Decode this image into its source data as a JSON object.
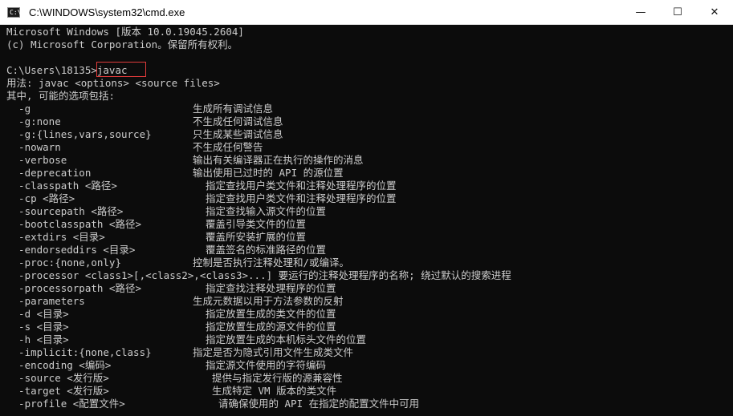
{
  "window": {
    "title": "C:\\WINDOWS\\system32\\cmd.exe",
    "icon_glyph": "C:\\",
    "minimize_glyph": "—",
    "maximize_glyph": "☐",
    "close_glyph": "✕"
  },
  "console": {
    "lines": [
      "Microsoft Windows [版本 10.0.19045.2604]",
      "(c) Microsoft Corporation。保留所有权利。",
      "",
      "C:\\Users\\18135>javac",
      "用法: javac <options> <source files>",
      "其中, 可能的选项包括:"
    ],
    "options": [
      {
        "flag": "  -g",
        "desc": "生成所有调试信息"
      },
      {
        "flag": "  -g:none",
        "desc": "不生成任何调试信息"
      },
      {
        "flag": "  -g:{lines,vars,source}",
        "desc": "只生成某些调试信息"
      },
      {
        "flag": "  -nowarn",
        "desc": "不生成任何警告"
      },
      {
        "flag": "  -verbose",
        "desc": "输出有关编译器正在执行的操作的消息"
      },
      {
        "flag": "  -deprecation",
        "desc": "输出使用已过时的 API 的源位置"
      },
      {
        "flag": "  -classpath <路径>",
        "desc": "指定查找用户类文件和注释处理程序的位置"
      },
      {
        "flag": "  -cp <路径>",
        "desc": "指定查找用户类文件和注释处理程序的位置"
      },
      {
        "flag": "  -sourcepath <路径>",
        "desc": "指定查找输入源文件的位置"
      },
      {
        "flag": "  -bootclasspath <路径>",
        "desc": "覆盖引导类文件的位置"
      },
      {
        "flag": "  -extdirs <目录>",
        "desc": "覆盖所安装扩展的位置"
      },
      {
        "flag": "  -endorseddirs <目录>",
        "desc": "覆盖签名的标准路径的位置"
      },
      {
        "flag": "  -proc:{none,only}",
        "desc": "控制是否执行注释处理和/或编译。"
      },
      {
        "flag": "  -processor <class1>[,<class2>,<class3>...] 要运行的注释处理程序的名称; 绕过默认的搜索进程",
        "desc": ""
      },
      {
        "flag": "  -processorpath <路径>",
        "desc": "指定查找注释处理程序的位置"
      },
      {
        "flag": "  -parameters",
        "desc": "生成元数据以用于方法参数的反射"
      },
      {
        "flag": "  -d <目录>",
        "desc": "指定放置生成的类文件的位置"
      },
      {
        "flag": "  -s <目录>",
        "desc": "指定放置生成的源文件的位置"
      },
      {
        "flag": "  -h <目录>",
        "desc": "指定放置生成的本机标头文件的位置"
      },
      {
        "flag": "  -implicit:{none,class}",
        "desc": "指定是否为隐式引用文件生成类文件"
      },
      {
        "flag": "  -encoding <编码>",
        "desc": "指定源文件使用的字符编码"
      },
      {
        "flag": "  -source <发行版>",
        "desc": "提供与指定发行版的源兼容性"
      },
      {
        "flag": "  -target <发行版>",
        "desc": "生成特定 VM 版本的类文件"
      },
      {
        "flag": "  -profile <配置文件>",
        "desc": "请确保使用的 API 在指定的配置文件中可用"
      }
    ]
  }
}
